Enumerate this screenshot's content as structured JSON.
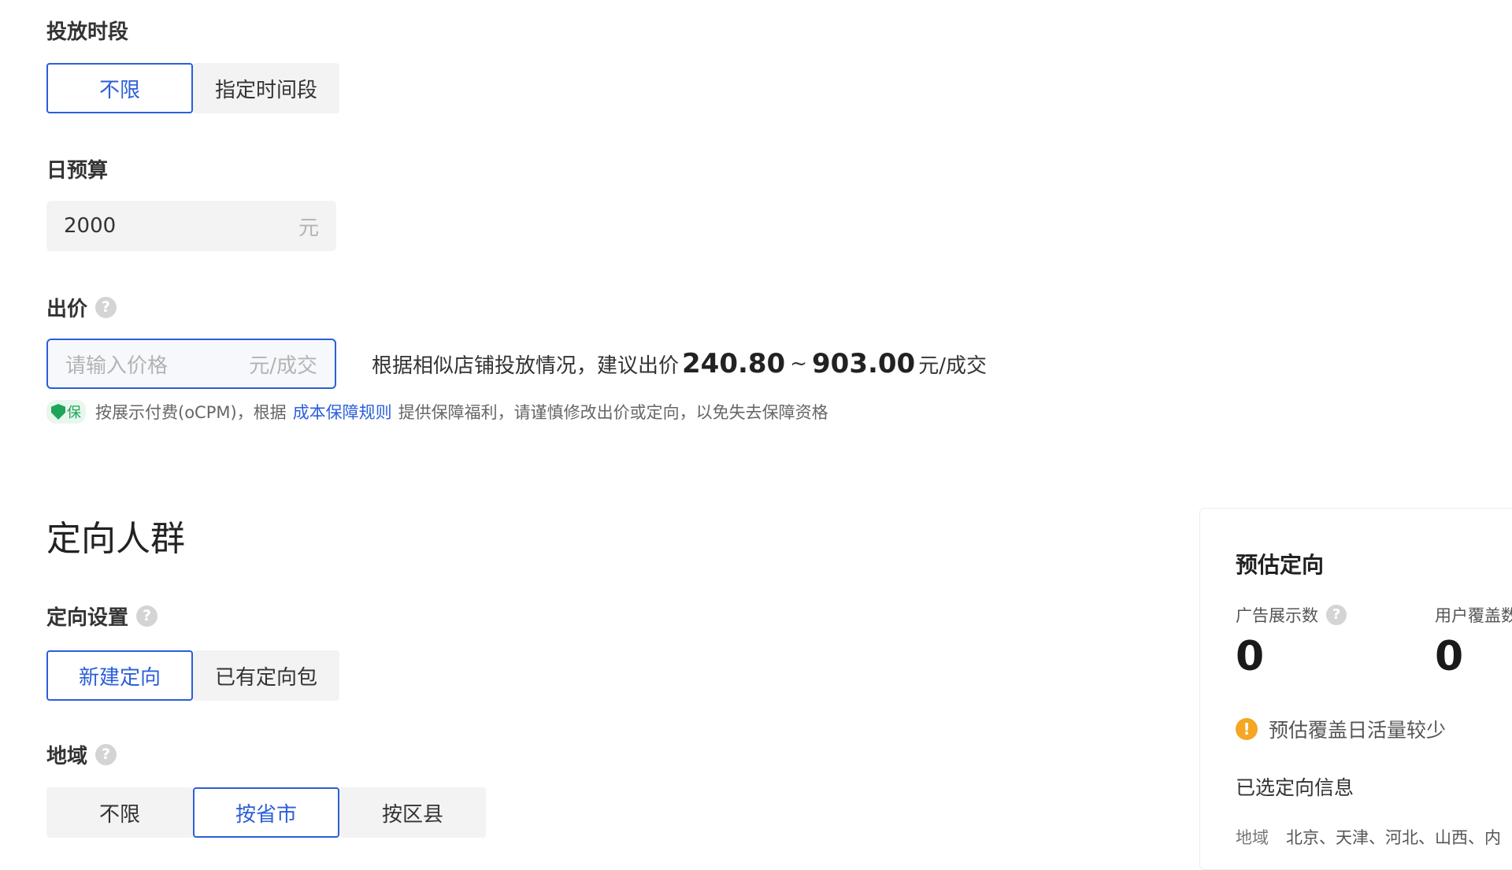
{
  "delivery_time": {
    "label": "投放时段",
    "options": [
      "不限",
      "指定时间段"
    ],
    "selected": "不限"
  },
  "daily_budget": {
    "label": "日预算",
    "value": "2000",
    "unit": "元"
  },
  "bid": {
    "label": "出价",
    "placeholder": "请输入价格",
    "unit": "元/成交",
    "hint_prefix": "根据相似店铺投放情况，建议出价",
    "min": "240.80",
    "tilde": "~",
    "max": "903.00",
    "hint_unit": "元/成交",
    "guarantee_badge": "保",
    "guarantee_text_1": "按展示付费(oCPM)，根据",
    "guarantee_link": "成本保障规则",
    "guarantee_text_2": "提供保障福利，请谨慎修改出价或定向，以免失去保障资格"
  },
  "targeting_section": {
    "title": "定向人群",
    "setting_label": "定向设置",
    "setting_options": [
      "新建定向",
      "已有定向包"
    ],
    "setting_selected": "新建定向",
    "region_label": "地域",
    "region_options": [
      "不限",
      "按省市",
      "按区县"
    ],
    "region_selected": "按省市"
  },
  "estimate_card": {
    "title": "预估定向",
    "ad_impressions_label": "广告展示数",
    "ad_impressions_value": "0",
    "user_coverage_label": "用户覆盖数",
    "user_coverage_value": "0",
    "warning": "预估覆盖日活量较少",
    "selected_info_title": "已选定向信息",
    "region_key": "地域",
    "region_value": "北京、天津、河北、山西、内"
  },
  "icons": {
    "help": "?",
    "warning": "!"
  },
  "colors": {
    "accent": "#2b5fd9",
    "guarantee_green": "#1fa55a",
    "warning_orange": "#f5a623"
  }
}
